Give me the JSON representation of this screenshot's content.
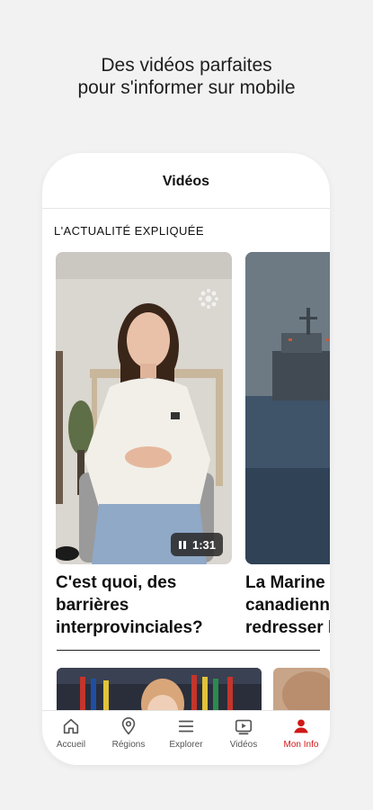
{
  "promo": {
    "line1": "Des vidéos parfaites",
    "line2": "pour s'informer sur mobile"
  },
  "app": {
    "title": "Vidéos",
    "section_title": "L'ACTUALITÉ EXPLIQUÉE",
    "cards": [
      {
        "title_lines": [
          "C'est quoi, des",
          "barrières",
          "interprovinciales?"
        ],
        "duration": "1:31"
      },
      {
        "title_lines": [
          "La Marine",
          "canadienne",
          "redresser l"
        ]
      }
    ]
  },
  "tabbar": {
    "items": [
      {
        "label": "Accueil",
        "icon": "home-icon"
      },
      {
        "label": "Régions",
        "icon": "location-pin-icon"
      },
      {
        "label": "Explorer",
        "icon": "menu-icon"
      },
      {
        "label": "Vidéos",
        "icon": "video-play-icon"
      },
      {
        "label": "Mon Info",
        "icon": "person-icon"
      }
    ],
    "active_index": 4
  },
  "colors": {
    "accent": "#d01818",
    "background": "#f2f2f2"
  }
}
